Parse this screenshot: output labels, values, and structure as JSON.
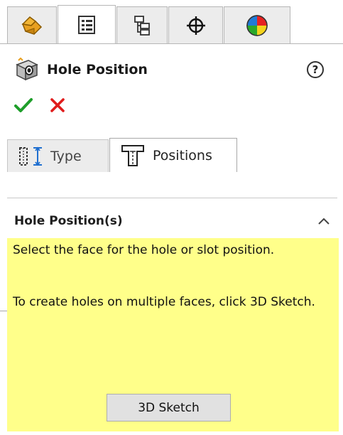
{
  "manager_tabs": [
    {
      "icon": "feature-manager-icon",
      "active": false
    },
    {
      "icon": "property-manager-icon",
      "active": true
    },
    {
      "icon": "configuration-manager-icon",
      "active": false
    },
    {
      "icon": "dimxpert-manager-icon",
      "active": false
    },
    {
      "icon": "display-manager-icon",
      "active": false
    }
  ],
  "header": {
    "title": "Hole Position",
    "help_label": "?"
  },
  "actions": {
    "ok_label": "✔",
    "cancel_label": "✕"
  },
  "property_tabs": {
    "type_label": "Type",
    "positions_label": "Positions",
    "active": "positions"
  },
  "group": {
    "title": "Hole Position(s)",
    "message_1": "Select the face for the hole or slot position.",
    "message_2": "To create holes on multiple faces, click 3D Sketch.",
    "sketch_button_label": "3D Sketch"
  },
  "colors": {
    "message_background": "#ffff8a",
    "ok_green": "#1e9e2a",
    "cancel_red": "#e01c1c"
  }
}
